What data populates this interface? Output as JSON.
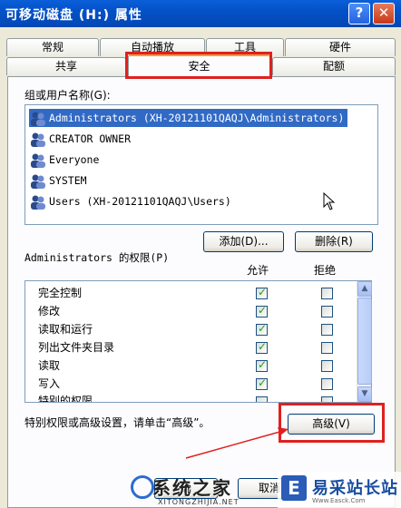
{
  "window": {
    "title": "可移动磁盘 (H:) 属性",
    "help_label": "?",
    "close_label": "✕"
  },
  "tabs": {
    "row1": [
      {
        "label": "常规"
      },
      {
        "label": "自动播放"
      },
      {
        "label": "工具"
      },
      {
        "label": "硬件"
      }
    ],
    "row2": [
      {
        "label": "共享"
      },
      {
        "label": "安全",
        "active": true
      },
      {
        "label": "配额"
      }
    ]
  },
  "security": {
    "group_label": "组或用户名称(G):",
    "users": [
      {
        "name": "Administrators (XH-20121101QAQJ\\Administrators)",
        "selected": true
      },
      {
        "name": "CREATOR OWNER"
      },
      {
        "name": "Everyone"
      },
      {
        "name": "SYSTEM"
      },
      {
        "name": "Users (XH-20121101QAQJ\\Users)"
      }
    ],
    "add_button": "添加(D)...",
    "remove_button": "删除(R)",
    "perm_label": "Administrators 的权限(P)",
    "allow_header": "允许",
    "deny_header": "拒绝",
    "permissions": [
      {
        "name": "完全控制",
        "allow": true,
        "deny": false
      },
      {
        "name": "修改",
        "allow": true,
        "deny": false
      },
      {
        "name": "读取和运行",
        "allow": true,
        "deny": false
      },
      {
        "name": "列出文件夹目录",
        "allow": true,
        "deny": false
      },
      {
        "name": "读取",
        "allow": true,
        "deny": false
      },
      {
        "name": "写入",
        "allow": true,
        "deny": false
      },
      {
        "name": "特别的权限",
        "allow": false,
        "deny": false
      }
    ],
    "advanced_hint": "特别权限或高级设置，请单击“高级”。",
    "advanced_button": "高级(V)"
  },
  "footer": {
    "ok_button": "确",
    "cancel_button": "取消"
  },
  "watermarks": {
    "left_title": "系统之家",
    "left_url": "XITONGZHIJIA.NET",
    "right_logo": "E",
    "right_title": "易采站长站",
    "right_url": "Www.Easck.Com"
  },
  "colors": {
    "titlebar": "#0451c8",
    "selection": "#316ac5",
    "highlight": "#e0201e",
    "active_tab": "#e7a237"
  }
}
